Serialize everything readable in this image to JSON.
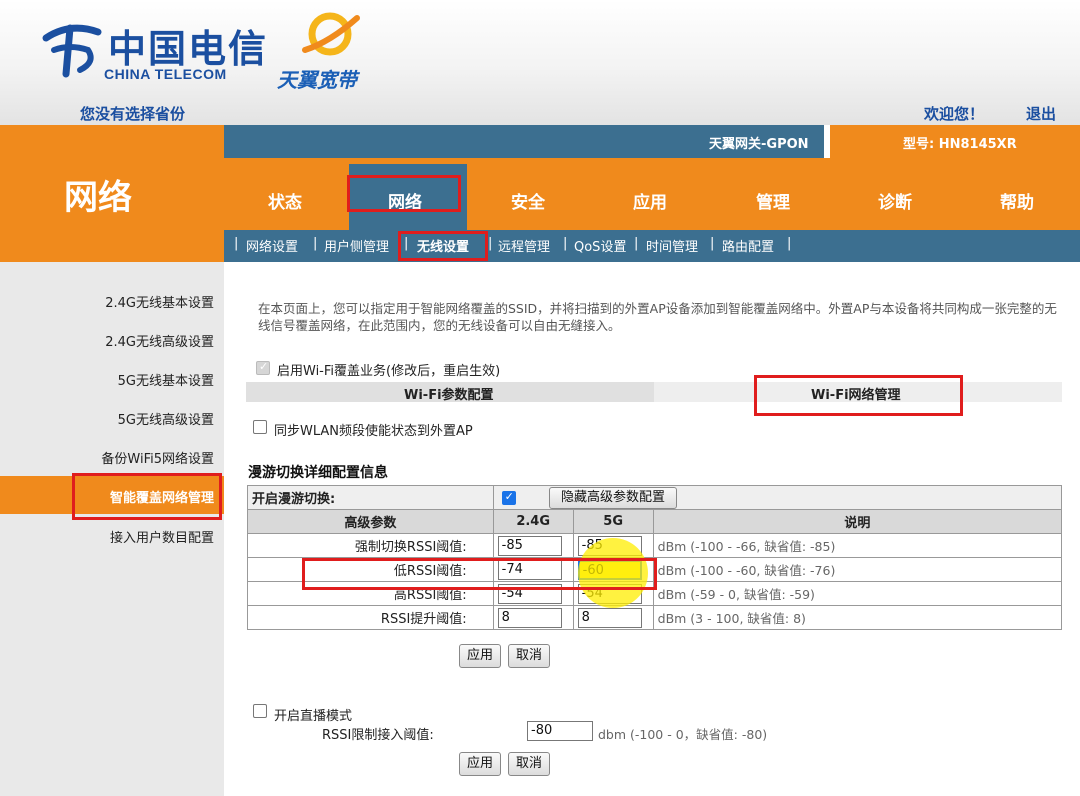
{
  "header": {
    "logo_cn": "中国电信",
    "logo_en": "CHINA TELECOM",
    "brand": "天翼宽带",
    "province": "您没有选择省份",
    "welcome": "欢迎您！",
    "logout": "退出",
    "gateway": "天翼网关-GPON",
    "model": "型号: HN8145XR"
  },
  "section_title": "网络",
  "tabs": [
    "状态",
    "网络",
    "安全",
    "应用",
    "管理",
    "诊断",
    "帮助"
  ],
  "subtabs": [
    "网络设置",
    "用户侧管理",
    "无线设置",
    "远程管理",
    "QoS设置",
    "时间管理",
    "路由配置"
  ],
  "left_nav": [
    "2.4G无线基本设置",
    "2.4G无线高级设置",
    "5G无线基本设置",
    "5G无线高级设置",
    "备份WiFi5网络设置",
    "智能覆盖网络管理",
    "接入用户数目配置"
  ],
  "content": {
    "intro": "在本页面上，您可以指定用于智能网络覆盖的SSID，并将扫描到的外置AP设备添加到智能覆盖网络中。外置AP与本设备将共同构成一张完整的无线信号覆盖网络，在此范围内，您的无线设备可以自由无缝接入。",
    "enable_wifi_coverage": "启用Wi-Fi覆盖业务(修改后，重启生效)",
    "wifi_param_tab": "Wi-Fi参数配置",
    "wifi_net_tab": "Wi-Fi网络管理",
    "sync_wlan": "同步WLAN频段使能状态到外置AP",
    "roam_section": "漫游切换详细配置信息",
    "roam_enable_label": "开启漫游切换:",
    "hide_adv_btn": "隐藏高级参数配置",
    "table_headers": [
      "高级参数",
      "2.4G",
      "5G",
      "说明"
    ],
    "rows": [
      {
        "name": "强制切换RSSI阈值:",
        "v24": "-85",
        "v5": "-85",
        "desc": "dBm (-100 - -66, 缺省值: -85)"
      },
      {
        "name": "低RSSI阈值:",
        "v24": "-74",
        "v5": "-60",
        "desc": "dBm (-100 - -60, 缺省值: -76)"
      },
      {
        "name": "高RSSI阈值:",
        "v24": "-54",
        "v5": "-54",
        "desc": "dBm (-59 - 0, 缺省值: -59)"
      },
      {
        "name": "RSSI提升阈值:",
        "v24": "8",
        "v5": "8",
        "desc": "dBm (3 - 100, 缺省值: 8)"
      }
    ],
    "apply": "应用",
    "cancel": "取消",
    "live_mode": "开启直播模式",
    "rssi_limit_label": "RSSI限制接入阈值:",
    "rssi_limit_value": "-80",
    "rssi_limit_desc": "dbm (-100 - 0，缺省值: -80)"
  },
  "colors": {
    "orange": "#f08a1c",
    "blue": "#3c6f90",
    "highlight": "#e01d1d"
  }
}
